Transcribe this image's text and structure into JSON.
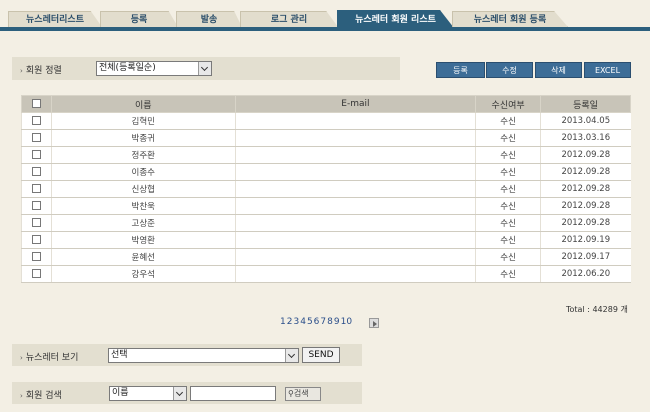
{
  "tabs": [
    "뉴스레터리스트",
    "등록",
    "발송",
    "로그 관리",
    "뉴스레터 회원 리스트",
    "뉴스레터 회원 등록"
  ],
  "active_tab": 4,
  "sort": {
    "label": "회원 정렬",
    "value": "전체(등록일순)"
  },
  "buttons": {
    "register": "등록",
    "edit": "수정",
    "delete": "삭제",
    "excel": "EXCEL"
  },
  "table": {
    "headers": [
      "",
      "이름",
      "E-mail",
      "수신여부",
      "등록일"
    ],
    "rows": [
      {
        "name": "김혁민",
        "email": "",
        "status": "수신",
        "date": "2013.04.05"
      },
      {
        "name": "박종귀",
        "email": "",
        "status": "수신",
        "date": "2013.03.16"
      },
      {
        "name": "정주환",
        "email": "",
        "status": "수신",
        "date": "2012.09.28"
      },
      {
        "name": "이종수",
        "email": "",
        "status": "수신",
        "date": "2012.09.28"
      },
      {
        "name": "신상협",
        "email": "",
        "status": "수신",
        "date": "2012.09.28"
      },
      {
        "name": "박찬욱",
        "email": "",
        "status": "수신",
        "date": "2012.09.28"
      },
      {
        "name": "고상준",
        "email": "",
        "status": "수신",
        "date": "2012.09.28"
      },
      {
        "name": "박영환",
        "email": "",
        "status": "수신",
        "date": "2012.09.19"
      },
      {
        "name": "윤혜선",
        "email": "",
        "status": "수신",
        "date": "2012.09.17"
      },
      {
        "name": "강우석",
        "email": "",
        "status": "수신",
        "date": "2012.06.20"
      }
    ]
  },
  "total": "Total : 44289 개",
  "pages": [
    "1",
    "2",
    "3",
    "4",
    "5",
    "6",
    "7",
    "8",
    "9",
    "10"
  ],
  "newsletter_view": {
    "label": "뉴스레터 보기",
    "value": "선택",
    "send": "SEND"
  },
  "member_search": {
    "label": "회원 검색",
    "field": "이름",
    "query": "",
    "button": "검색"
  }
}
